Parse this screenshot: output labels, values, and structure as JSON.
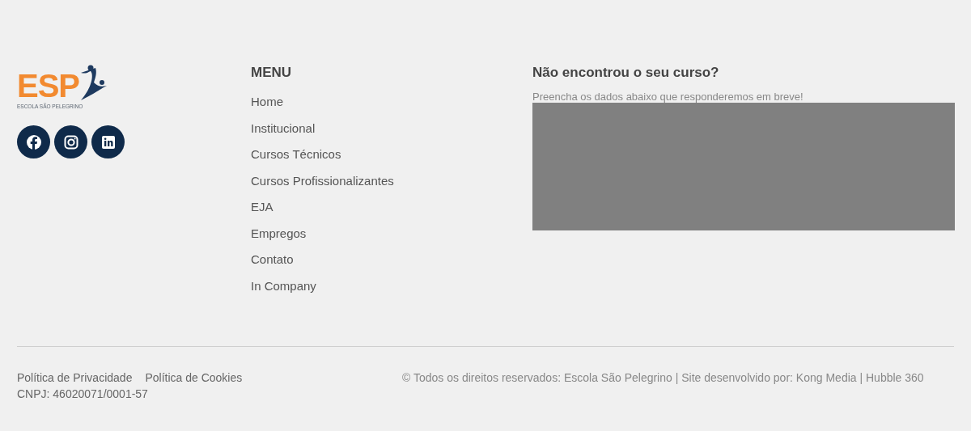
{
  "logo": {
    "mark": "ESP",
    "name": "ESCOLA SÃO PELEGRINO"
  },
  "social": [
    {
      "kind": "facebook"
    },
    {
      "kind": "instagram"
    },
    {
      "kind": "linkedin"
    }
  ],
  "menu": {
    "title": "MENU",
    "items": [
      "Home",
      "Institucional",
      "Cursos Técnicos",
      "Cursos Profissionalizantes",
      "EJA",
      "Empregos",
      "Contato",
      "In Company"
    ]
  },
  "contact": {
    "title": "Não encontrou o seu curso?",
    "subtitle": "Preencha os dados abaixo que responderemos em breve!"
  },
  "bottom": {
    "links": [
      "Política de Privacidade",
      "Política de Cookies"
    ],
    "cnpj": "CNPJ: 46020071/0001-57",
    "copyright": "© Todos os direitos reservados: Escola São Pelegrino | Site desenvolvido por: Kong Media | Hubble 360"
  }
}
